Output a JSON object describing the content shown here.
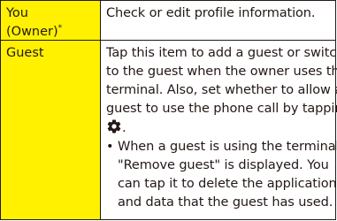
{
  "rows": [
    {
      "head_line1": "You",
      "head_line2": "(Owner)",
      "head_note": "*",
      "body": "Check or edit profile information."
    },
    {
      "head": "Guest",
      "body_lines": [
        "Tap this item to add a guest or switch",
        "to the guest when the owner uses the",
        "terminal. Also, set whether to allow a",
        "guest to use the phone call by tapping"
      ],
      "after_icon": ".",
      "icon": "gear-icon",
      "bullet": "•",
      "bullet_lines": [
        "When a guest is using the terminal,",
        "\"Remove guest\" is displayed. You",
        "can tap it to delete the applications",
        "and data that the guest has used."
      ]
    }
  ],
  "colors": {
    "header_bg": "#fff100",
    "text": "#231815",
    "border": "#231815"
  }
}
